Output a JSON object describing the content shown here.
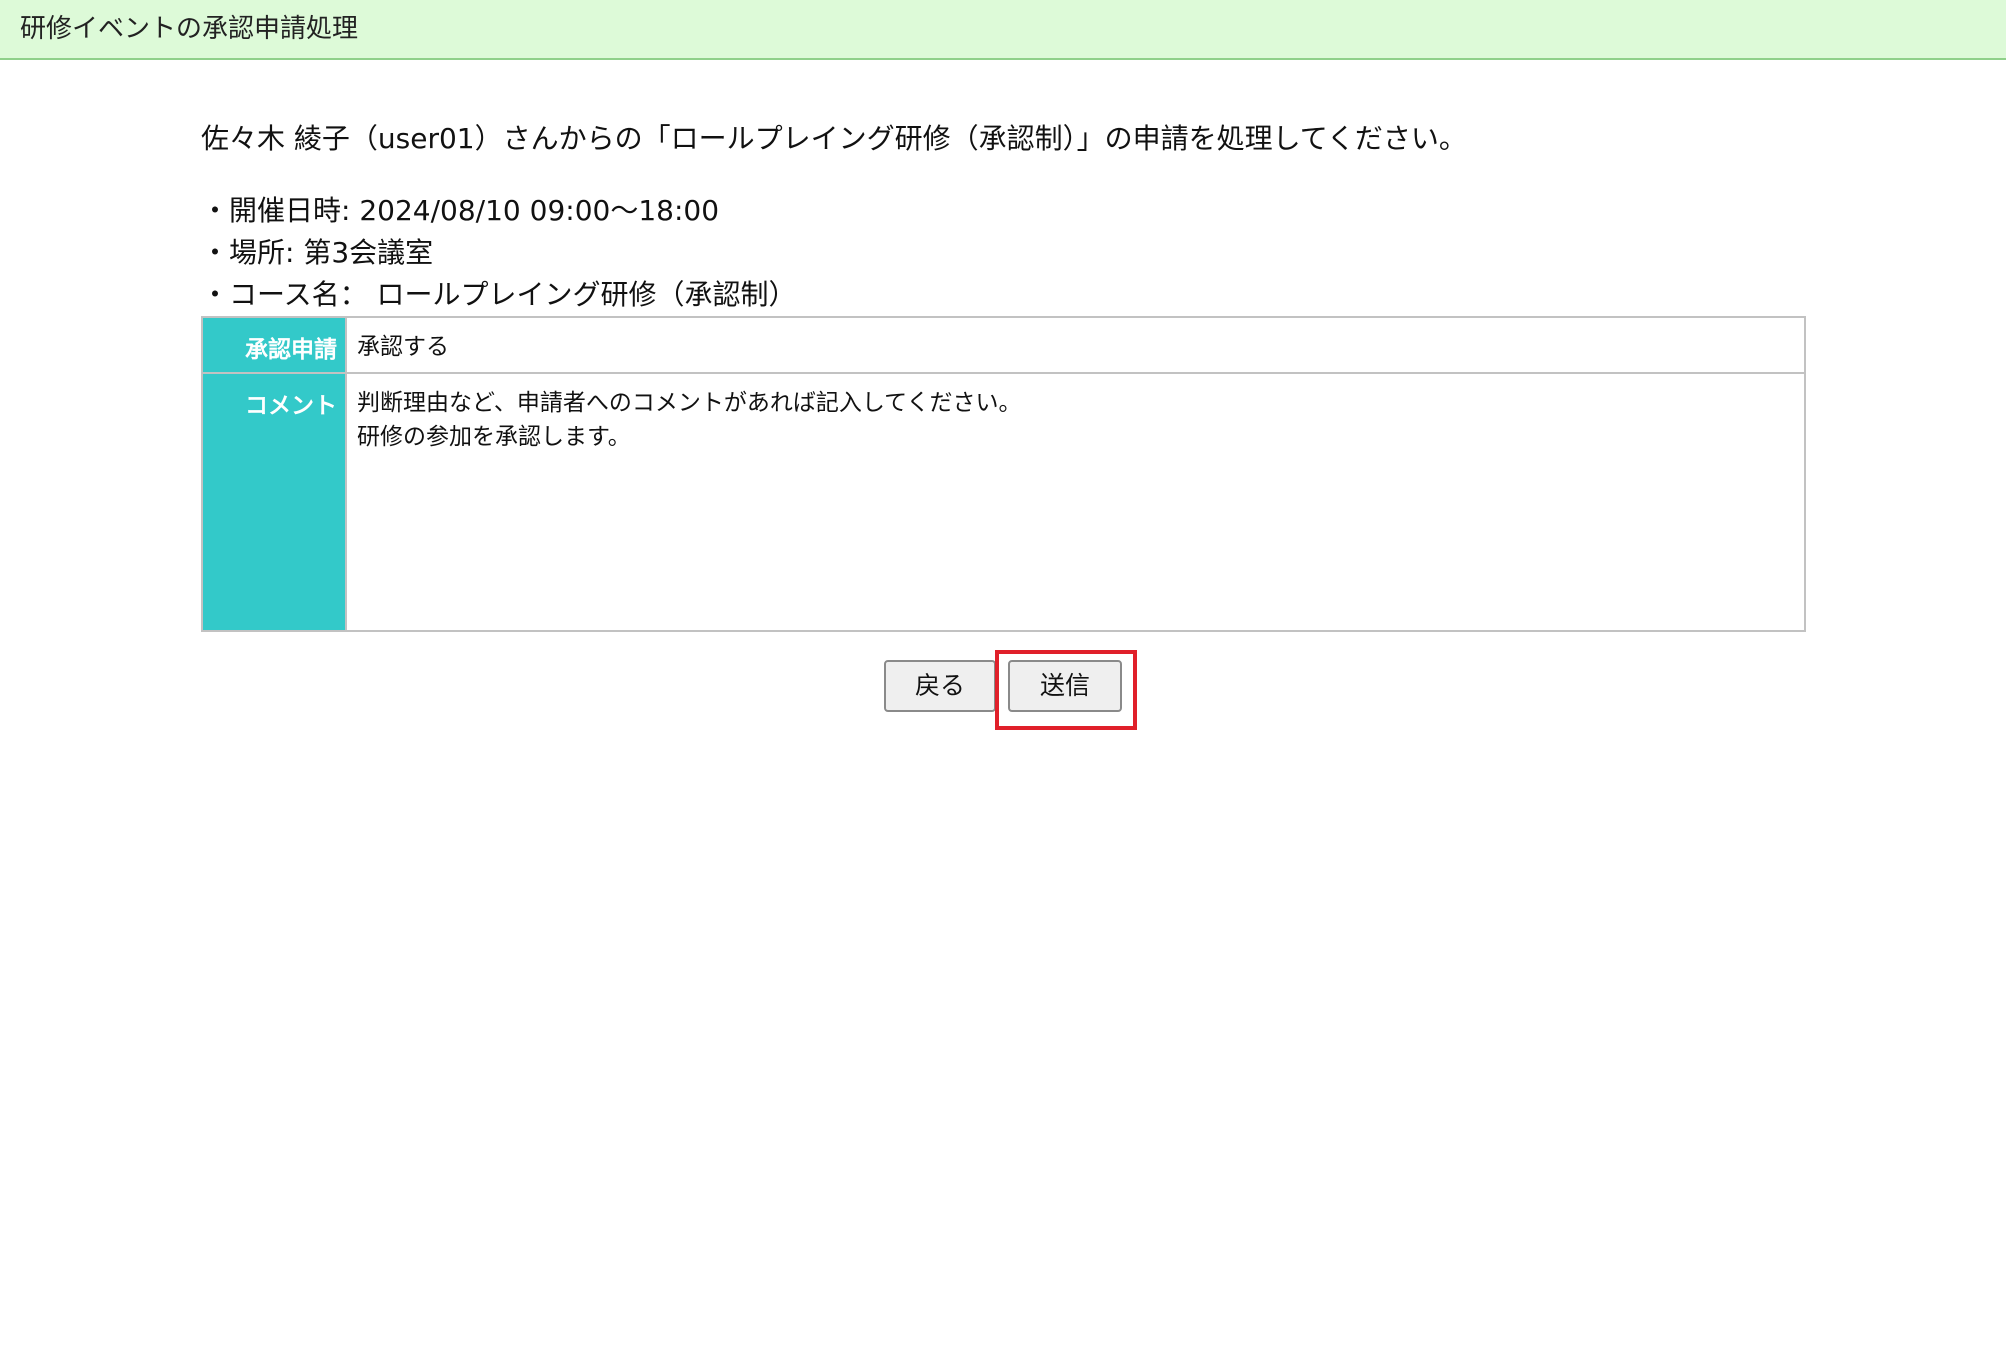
{
  "header": {
    "title": "研修イベントの承認申請処理"
  },
  "intro": {
    "message": "佐々木 綾子（user01）さんからの「ロールプレイング研修（承認制）」の申請を処理してください。"
  },
  "details": {
    "date_label": "・開催日時:",
    "date_value": "2024/08/10 09:00〜18:00",
    "place_label": "・場所:",
    "place_value": "第3会議室",
    "course_label": "・コース名：",
    "course_value": "ロールプレイング研修（承認制）"
  },
  "form": {
    "approval_label": "承認申請",
    "approval_value": "承認する",
    "comment_label": "コメント",
    "comment_placeholder": "判断理由など、申請者へのコメントがあれば記入してください。",
    "comment_value": "研修の参加を承認します。"
  },
  "buttons": {
    "back_label": "戻る",
    "send_label": "送信"
  },
  "colors": {
    "header_bg": "#ddfad8",
    "label_cell_bg": "#33c9c9",
    "highlight_border": "#e0202a"
  }
}
